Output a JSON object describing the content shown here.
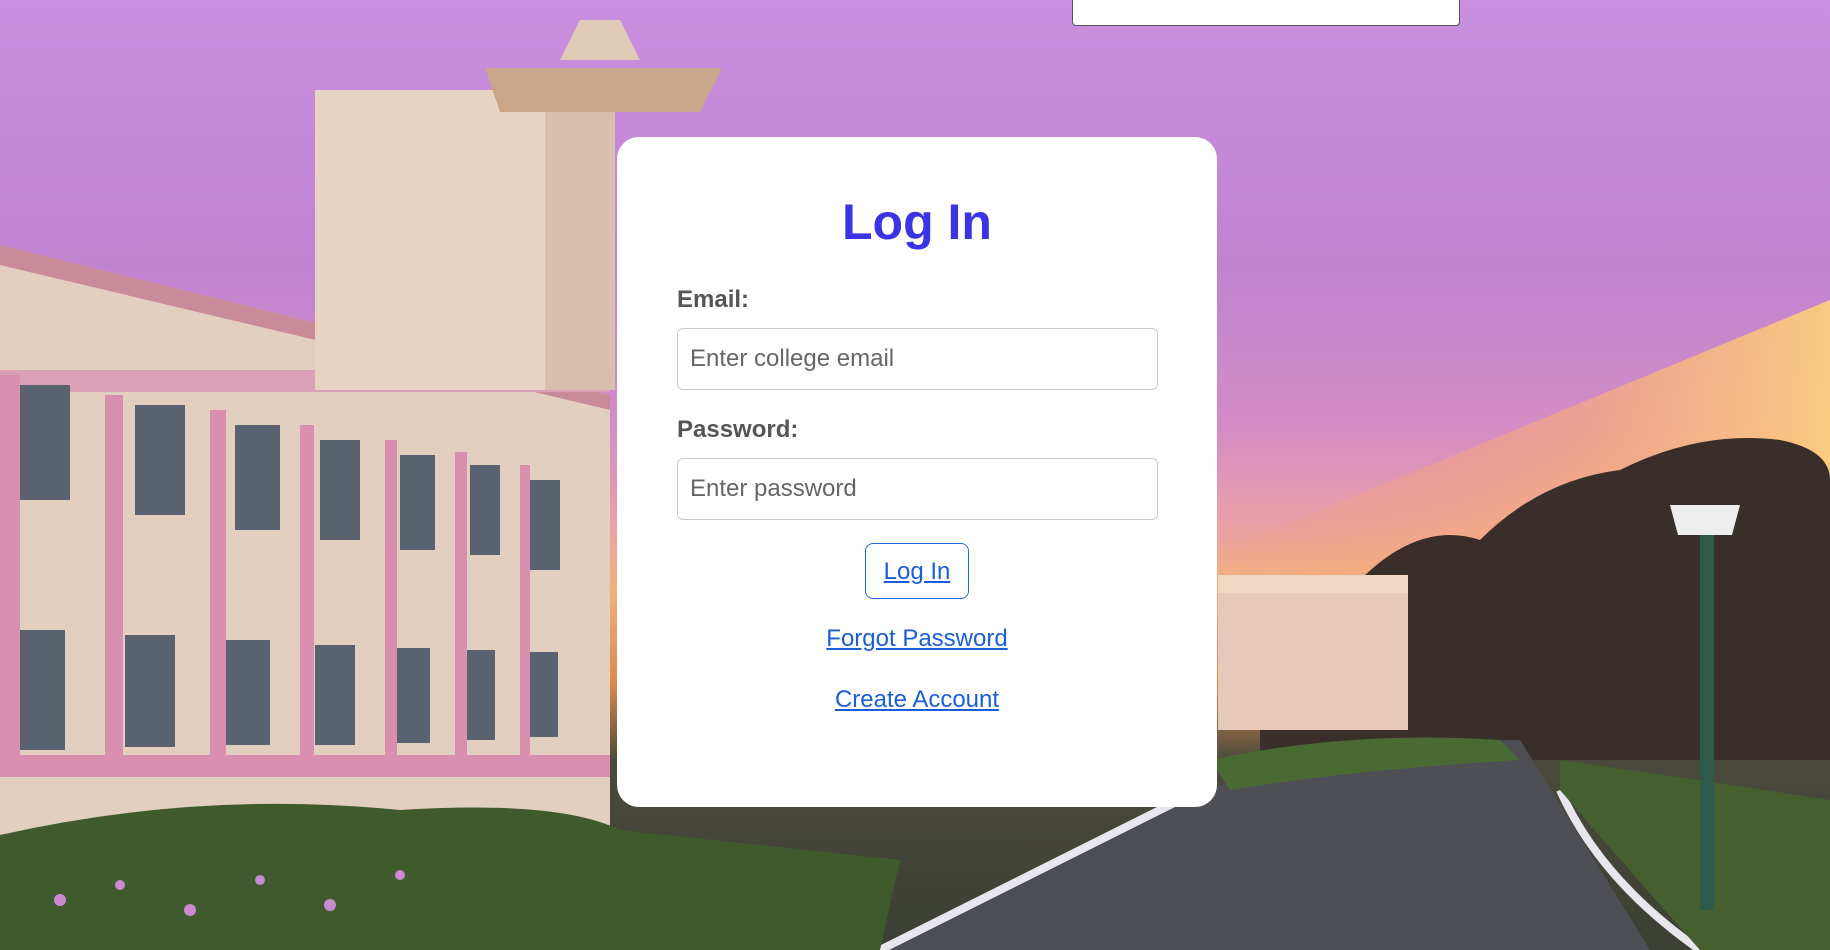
{
  "login": {
    "title": "Log In",
    "email_label": "Email:",
    "email_placeholder": "Enter college email",
    "email_value": "",
    "password_label": "Password:",
    "password_placeholder": "Enter password",
    "password_value": "",
    "submit_label": "Log In",
    "forgot_label": "Forgot Password",
    "create_label": "Create Account"
  },
  "colors": {
    "title": "#3a34e4",
    "link": "#1a5fd8",
    "card": "#ffffff"
  }
}
